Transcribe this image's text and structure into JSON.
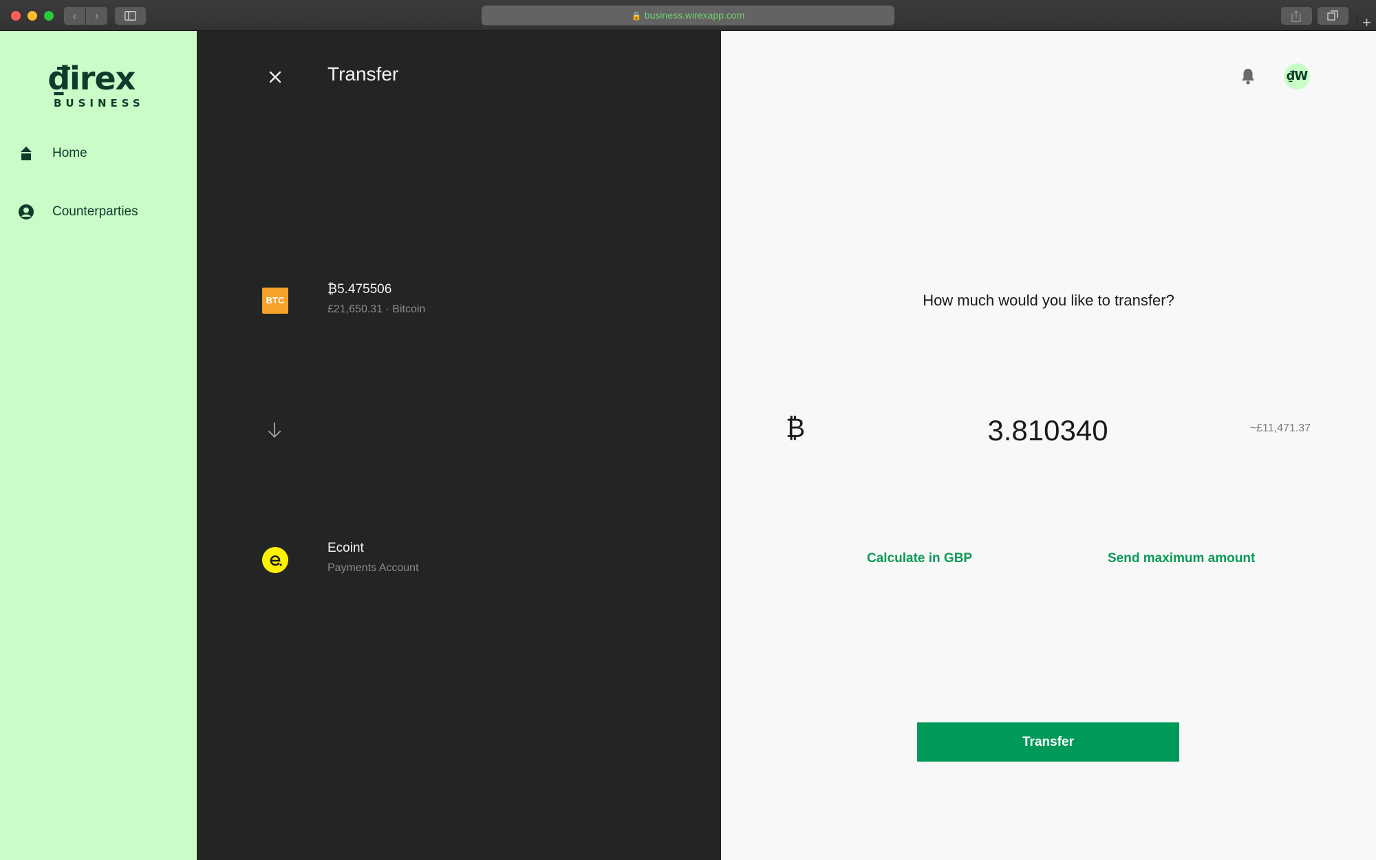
{
  "browser": {
    "url": "business.wirexapp.com"
  },
  "sidebar": {
    "logo": {
      "word": "₫irex",
      "sub": "BUSINESS"
    },
    "items": [
      {
        "label": "Home",
        "icon": "home-icon"
      },
      {
        "label": "Counterparties",
        "icon": "user-circle-icon"
      }
    ]
  },
  "transfer_panel": {
    "title": "Transfer",
    "from": {
      "badge": "BTC",
      "balance": "₿5.475506",
      "details": "£21,650.31 · Bitcoin"
    },
    "to": {
      "name": "Ecoint",
      "details": "Payments Account"
    }
  },
  "amount_panel": {
    "question": "How much would you like to transfer?",
    "currency_symbol": "₿",
    "amount": "3.810340",
    "approx": "~£11,471.37",
    "calc_link": "Calculate in GBP",
    "max_link": "Send maximum amount",
    "submit_label": "Transfer",
    "avatar_text": "₫W"
  },
  "colors": {
    "sidebar_bg": "#c9fdc7",
    "dark_panel_bg": "#232424",
    "accent_green": "#009a58",
    "btc_orange": "#f4a22a",
    "ecoint_yellow": "#fff200"
  }
}
